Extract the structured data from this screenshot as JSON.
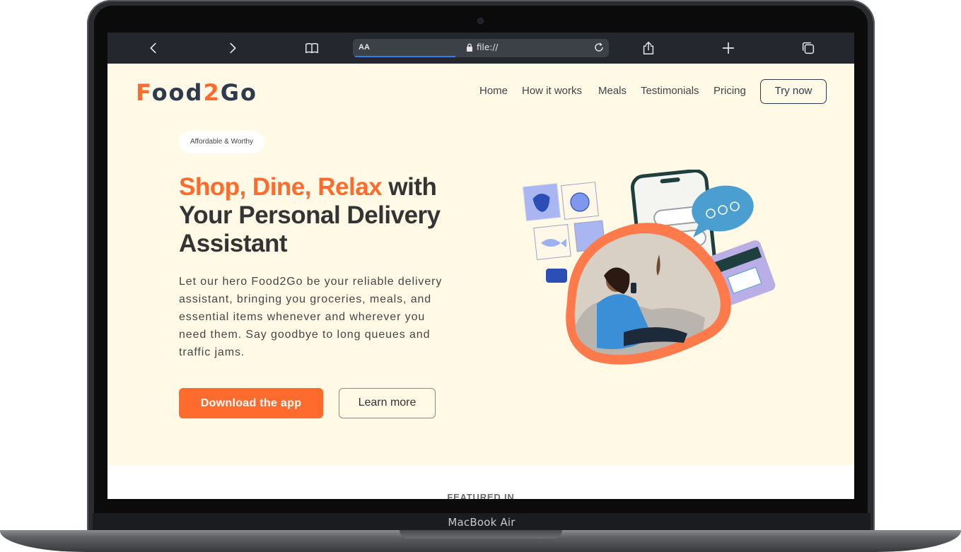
{
  "device": {
    "label": "MacBook Air"
  },
  "browser": {
    "address_text_size": "AA",
    "url": "file://"
  },
  "site": {
    "logo": {
      "f": "F",
      "o1": "o",
      "o2": "o",
      "d": "d",
      "two": "2",
      "go": "Go"
    },
    "nav": [
      "Home",
      "How it works",
      "Meals",
      "Testimonials",
      "Pricing"
    ],
    "cta": "Try now"
  },
  "hero": {
    "badge": "Affordable & Worthy",
    "headline_accent": "Shop, Dine, Relax",
    "headline_rest": " with Your Personal Delivery Assistant",
    "description": "Let our hero Food2Go be your reliable delivery assistant, bringing you groceries, meals, and essential items whenever and wherever you need them. Say goodbye to long queues and traffic jams.",
    "primary_button": "Download the app",
    "secondary_button": "Learn more"
  },
  "featured": {
    "heading": "FEATURED IN"
  },
  "colors": {
    "accent": "#ff6b2c",
    "dark_text": "#343434",
    "navy": "#2e3a4e",
    "page_background": "#fff9e6",
    "browser_bar": "#24282e",
    "chat_bubble": "#4a9fd0",
    "card": "#b9aee6"
  }
}
